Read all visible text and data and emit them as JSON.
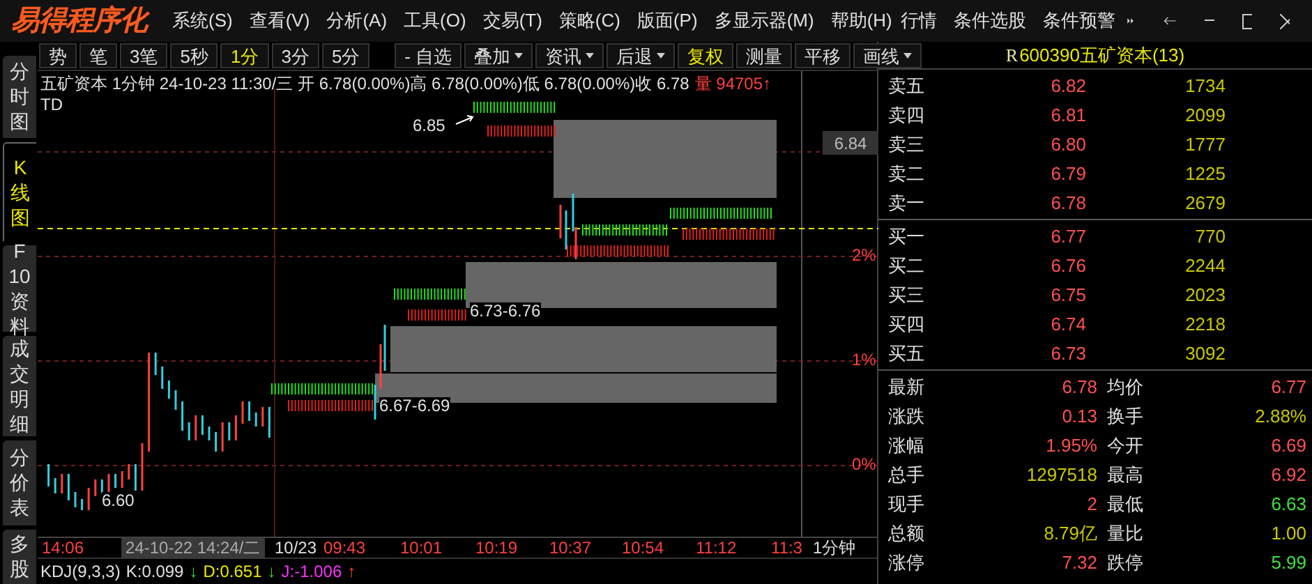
{
  "menu": {
    "logo": "易得程序化",
    "items": [
      "系统(S)",
      "查看(V)",
      "分析(A)",
      "工具(O)",
      "交易(T)",
      "策略(C)",
      "版面(P)",
      "多显示器(M)",
      "帮助(H)"
    ],
    "right_items": [
      "行情",
      "条件选股",
      "条件预警"
    ]
  },
  "toolbar": [
    {
      "label": "势",
      "selected": false,
      "dropdown": false
    },
    {
      "label": "笔",
      "selected": false,
      "dropdown": false
    },
    {
      "label": "3笔",
      "selected": false,
      "dropdown": false
    },
    {
      "label": "5秒",
      "selected": false,
      "dropdown": false
    },
    {
      "label": "1分",
      "selected": true,
      "dropdown": false
    },
    {
      "label": "3分",
      "selected": false,
      "dropdown": false
    },
    {
      "label": "5分",
      "selected": false,
      "dropdown": false
    },
    {
      "label": "- 自选",
      "selected": false,
      "dropdown": false
    },
    {
      "label": "叠加",
      "selected": false,
      "dropdown": true
    },
    {
      "label": "资讯",
      "selected": false,
      "dropdown": true
    },
    {
      "label": "后退",
      "selected": false,
      "dropdown": true
    },
    {
      "label": "复权",
      "selected": true,
      "dropdown": false
    },
    {
      "label": "测量",
      "selected": false,
      "dropdown": false
    },
    {
      "label": "平移",
      "selected": false,
      "dropdown": false
    },
    {
      "label": "画线",
      "selected": false,
      "dropdown": true
    }
  ],
  "side_tabs": [
    {
      "label": "分时图",
      "selected": false
    },
    {
      "label": "K线图",
      "selected": true
    },
    {
      "label": "F10资料",
      "selected": false
    },
    {
      "label": "成交明细",
      "selected": false
    },
    {
      "label": "分价表",
      "selected": false
    },
    {
      "label": "多股",
      "selected": false
    }
  ],
  "chart": {
    "info": [
      {
        "text": "五矿资本 1分钟 24-10-23 11:30/三 开 6.78(0.00%)高 6.78(0.00%)低 6.78(0.00%)收 6.78",
        "color": "#e0e0e0"
      },
      {
        "text": "量 94705↑",
        "color": "#ff4040"
      }
    ],
    "indicator": "TD",
    "price_labels": [
      "6.85",
      "6.73-6.76",
      "6.67-6.69",
      "6.60"
    ],
    "axis_price": "6.84",
    "axis_percent": [
      "2%",
      "1%",
      "0%"
    ],
    "time_labels": [
      {
        "text": "14:06",
        "kind": "time"
      },
      {
        "text": "24-10-22 14:24/二",
        "kind": "cursor"
      },
      {
        "text": "10/23",
        "kind": "date"
      },
      {
        "text": "09:43",
        "kind": "time"
      },
      {
        "text": "10:01",
        "kind": "time"
      },
      {
        "text": "10:19",
        "kind": "time"
      },
      {
        "text": "10:37",
        "kind": "time"
      },
      {
        "text": "10:54",
        "kind": "time"
      },
      {
        "text": "11:12",
        "kind": "time"
      },
      {
        "text": "11:3",
        "kind": "time"
      }
    ],
    "period": "1分钟"
  },
  "kdj": [
    {
      "text": "KDJ(9,3,3)",
      "color": "#e0e0e0"
    },
    {
      "text": "K:0.099",
      "color": "#e0e0e0"
    },
    {
      "text": "↓",
      "color": "#30e030"
    },
    {
      "text": "D:0.651",
      "color": "#e8e800"
    },
    {
      "text": "↓",
      "color": "#30e030"
    },
    {
      "text": "J:-1.006",
      "color": "#ff30ff"
    },
    {
      "text": "↑",
      "color": "#ff4040"
    }
  ],
  "quote": {
    "code": "R",
    "title": "600390五矿资本(13)",
    "asks": [
      {
        "label": "卖五",
        "price": "6.82",
        "volume": "1734"
      },
      {
        "label": "卖四",
        "price": "6.81",
        "volume": "2099"
      },
      {
        "label": "卖三",
        "price": "6.80",
        "volume": "1777"
      },
      {
        "label": "卖二",
        "price": "6.79",
        "volume": "1225"
      },
      {
        "label": "卖一",
        "price": "6.78",
        "volume": "2679"
      }
    ],
    "bids": [
      {
        "label": "买一",
        "price": "6.77",
        "volume": "770"
      },
      {
        "label": "买二",
        "price": "6.76",
        "volume": "2244"
      },
      {
        "label": "买三",
        "price": "6.75",
        "volume": "2023"
      },
      {
        "label": "买四",
        "price": "6.74",
        "volume": "2218"
      },
      {
        "label": "买五",
        "price": "6.73",
        "volume": "3092"
      }
    ],
    "stats": [
      {
        "label": "最新",
        "value": "6.78",
        "color": "#ff5050"
      },
      {
        "label": "均价",
        "value": "6.77",
        "color": "#ff5050"
      },
      {
        "label": "涨跌",
        "value": "0.13",
        "color": "#ff5050"
      },
      {
        "label": "换手",
        "value": "2.88%",
        "color": "#c8c800"
      },
      {
        "label": "涨幅",
        "value": "1.95%",
        "color": "#ff5050"
      },
      {
        "label": "今开",
        "value": "6.69",
        "color": "#ff5050"
      },
      {
        "label": "总手",
        "value": "1297518",
        "color": "#c8c800"
      },
      {
        "label": "最高",
        "value": "6.92",
        "color": "#ff5050"
      },
      {
        "label": "现手",
        "value": "2",
        "color": "#ff5050"
      },
      {
        "label": "最低",
        "value": "6.63",
        "color": "#40e040"
      },
      {
        "label": "总额",
        "value": "8.79亿",
        "color": "#c8c800"
      },
      {
        "label": "量比",
        "value": "1.00",
        "color": "#c8c800"
      },
      {
        "label": "涨停",
        "value": "7.32",
        "color": "#ff5050"
      },
      {
        "label": "跌停",
        "value": "5.99",
        "color": "#40e040"
      }
    ]
  }
}
